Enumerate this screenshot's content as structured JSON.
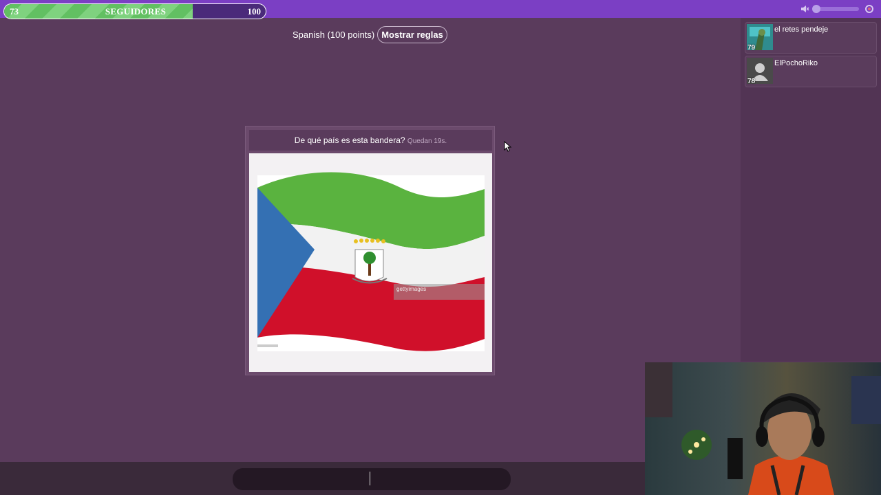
{
  "followers": {
    "level_left": "73",
    "title": "SEGUIDORES",
    "level_right": "100",
    "progress": 0.72
  },
  "topbar": {
    "icons": [
      "mute-icon",
      "volume-slider",
      "settings-icon"
    ]
  },
  "mode": {
    "label": "Spanish (100 points)",
    "rules_button": "Mostrar reglas"
  },
  "players": [
    {
      "name": "el retes pendeje",
      "score": "79",
      "avatar": "custom-avatar"
    },
    {
      "name": "ElPochoRiko",
      "score": "78",
      "avatar": "default-avatar"
    }
  ],
  "question": {
    "text": "De qué país es esta bandera?",
    "time_left": "Quedan 19s."
  },
  "flag": {
    "country_hint": "equatorial-guinea",
    "watermark": "gettyimages",
    "colors": {
      "green": "#5ab33f",
      "white": "#f4f4f4",
      "red": "#d0102a",
      "blue": "#3470b3"
    }
  },
  "chat": {
    "placeholder": ""
  }
}
